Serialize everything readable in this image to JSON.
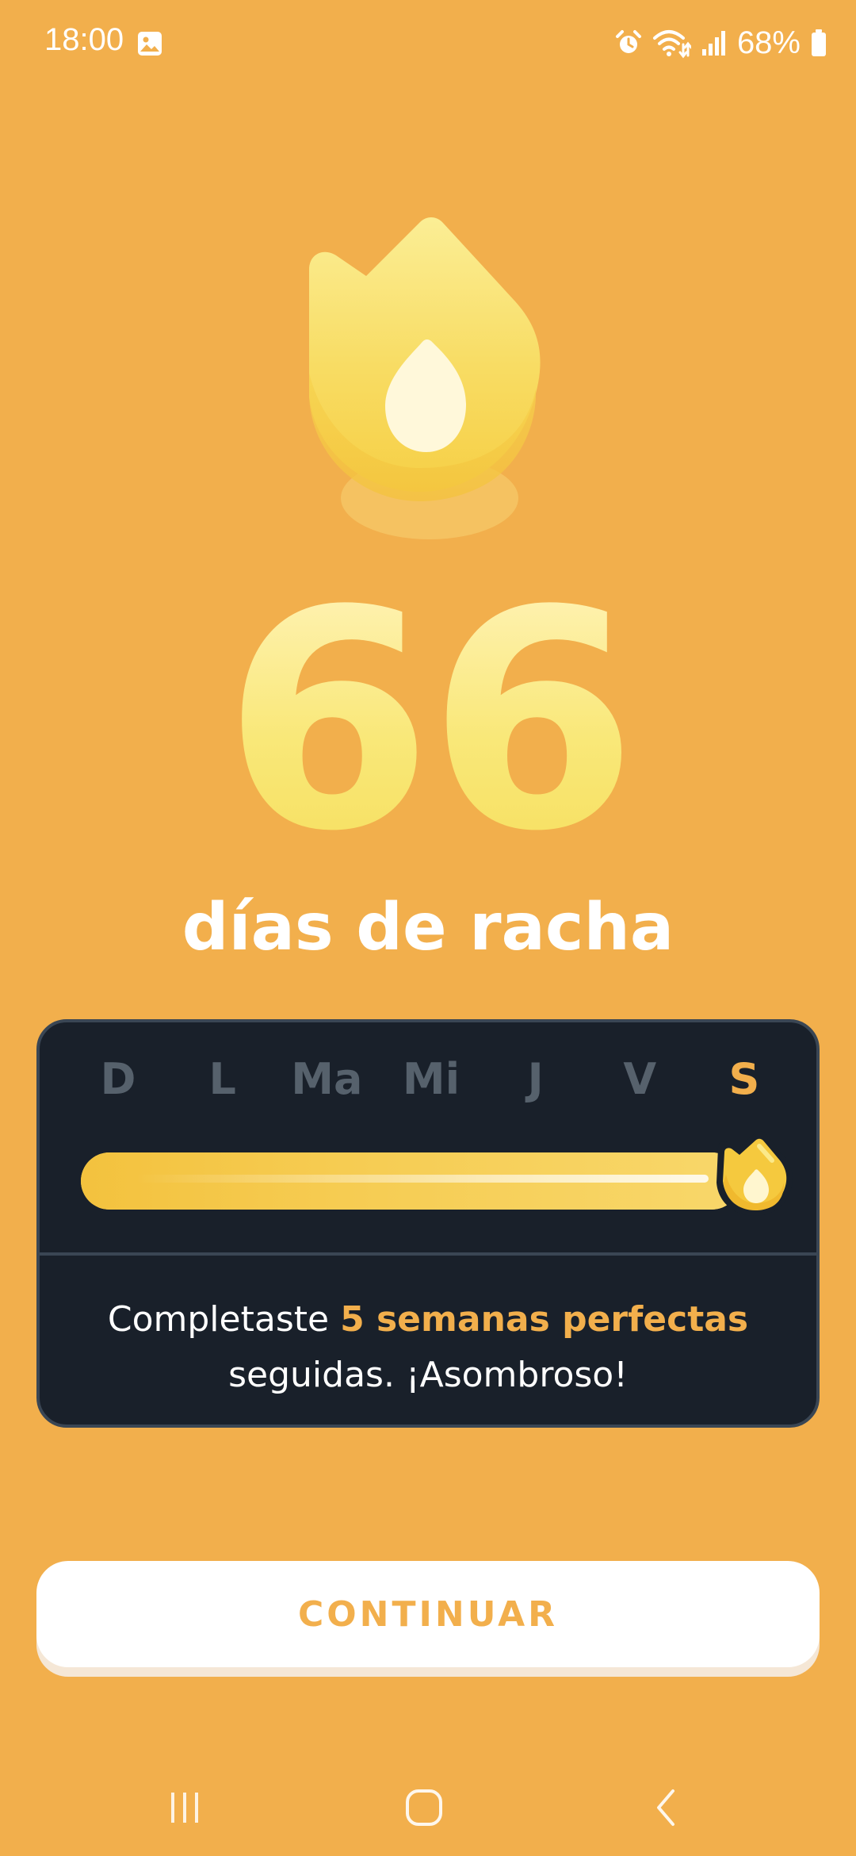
{
  "status_bar": {
    "time": "18:00",
    "battery_percent": "68%",
    "icons": [
      "gallery-icon",
      "alarm-icon",
      "wifi-icon",
      "signal-icon",
      "battery-icon"
    ]
  },
  "streak": {
    "count": "66",
    "label": "días de racha"
  },
  "week": {
    "days": [
      "D",
      "L",
      "Ma",
      "Mi",
      "J",
      "V",
      "S"
    ],
    "active_day_index": 6,
    "progress_fraction": 1.0,
    "message_prefix": "Completaste ",
    "message_highlight": "5 semanas perfectas",
    "message_suffix": "seguidas. ¡Asombroso!"
  },
  "continue_button": {
    "label": "CONTINUAR"
  },
  "nav_bar": {
    "buttons": [
      "recent-apps-icon",
      "home-icon",
      "back-icon"
    ]
  },
  "colors": {
    "background": "#F2AF4C",
    "card": "#19202A",
    "card_border": "#3A4654",
    "accent": "#F2AF4C",
    "inactive_day": "#56616C",
    "flame_yellow": "#F7D24E"
  }
}
